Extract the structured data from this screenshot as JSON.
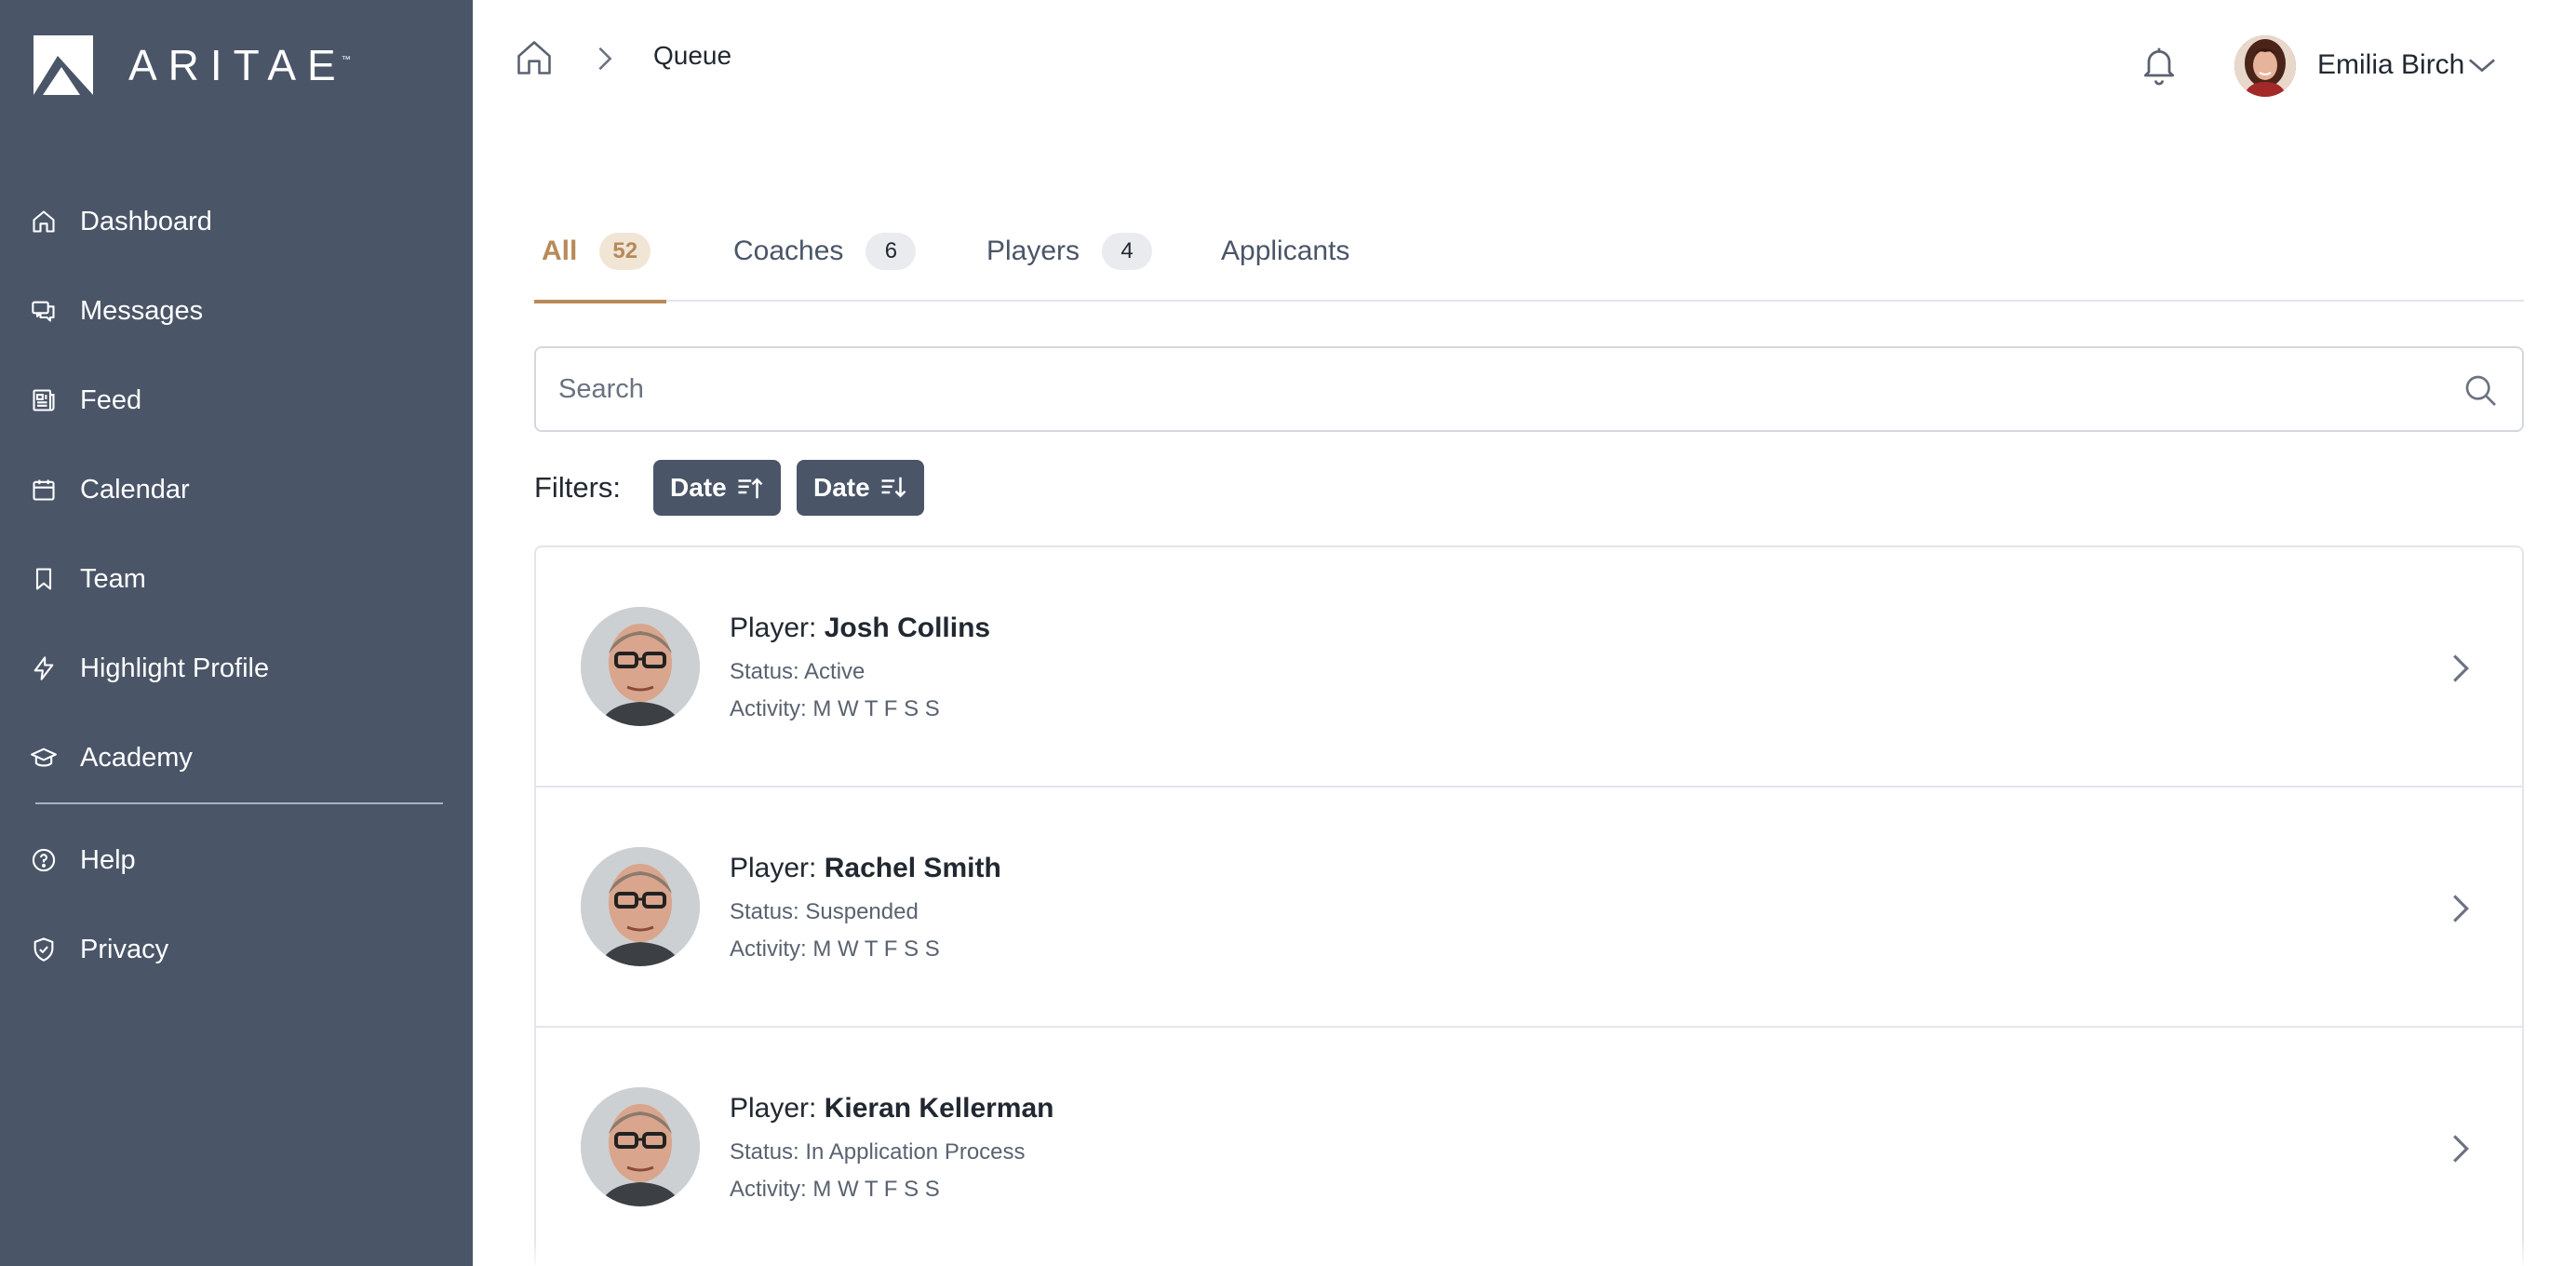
{
  "brand": {
    "name": "ARITAE",
    "tm": "™"
  },
  "sidebar": {
    "items": [
      {
        "label": "Dashboard",
        "icon": "home-icon"
      },
      {
        "label": "Messages",
        "icon": "messages-icon"
      },
      {
        "label": "Feed",
        "icon": "feed-icon"
      },
      {
        "label": "Calendar",
        "icon": "calendar-icon"
      },
      {
        "label": "Team",
        "icon": "bookmark-icon"
      },
      {
        "label": "Highlight Profile",
        "icon": "lightning-icon"
      },
      {
        "label": "Academy",
        "icon": "graduation-cap-icon"
      }
    ],
    "secondary": [
      {
        "label": "Help",
        "icon": "help-icon"
      },
      {
        "label": "Privacy",
        "icon": "shield-icon"
      }
    ]
  },
  "header": {
    "breadcrumb": "Queue",
    "user_name": "Emilia Birch"
  },
  "tabs": [
    {
      "label": "All",
      "count": "52",
      "active": true
    },
    {
      "label": "Coaches",
      "count": "6",
      "active": false
    },
    {
      "label": "Players",
      "count": "4",
      "active": false
    },
    {
      "label": "Applicants",
      "count": "",
      "active": false
    }
  ],
  "search": {
    "placeholder": "Search"
  },
  "filters": {
    "label": "Filters:",
    "chips": [
      {
        "label": "Date",
        "icon": "sort-ascending-icon"
      },
      {
        "label": "Date",
        "icon": "sort-descending-icon"
      }
    ]
  },
  "queue": [
    {
      "role": "Player:",
      "name": "Josh Collins",
      "status": "Status: Active",
      "activity": "Activity: M W T F S S"
    },
    {
      "role": "Player:",
      "name": "Rachel Smith",
      "status": "Status: Suspended",
      "activity": "Activity: M W T F S S"
    },
    {
      "role": "Player:",
      "name": "Kieran Kellerman",
      "status": "Status: In Application Process",
      "activity": "Activity: M W T F S S"
    }
  ],
  "colors": {
    "sidebar": "#4a5568",
    "accent": "#b88a5a",
    "chip": "#4a5568"
  }
}
